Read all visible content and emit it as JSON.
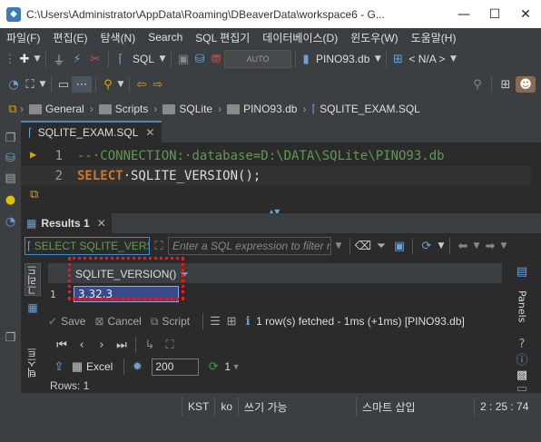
{
  "window": {
    "title": "C:\\Users\\Administrator\\AppData\\Roaming\\DBeaverData\\workspace6 - G...",
    "minimize": "—",
    "maximize": "☐",
    "close": "✕"
  },
  "menu": [
    "파일(F)",
    "편집(E)",
    "탐색(N)",
    "Search",
    "SQL 편집기",
    "데이터베이스(D)",
    "윈도우(W)",
    "도움말(H)"
  ],
  "toolbar1": {
    "sql_label": "SQL",
    "database": "PINO93.db",
    "schema": "< N/A >",
    "auto_label": "AUTO"
  },
  "breadcrumb": [
    "General",
    "Scripts",
    "SQLite",
    "PINO93.db",
    "SQLITE_EXAM.SQL"
  ],
  "editor": {
    "tab_label": "SQLITE_EXAM.SQL",
    "lines": [
      {
        "num": "1",
        "text": "--·CONNECTION:·database=D:\\DATA\\SQLite\\PINO93.db"
      },
      {
        "num": "2",
        "keyword": "SELECT",
        "rest": "·SQLITE_VERSION();"
      }
    ]
  },
  "results": {
    "tab_label": "Results 1",
    "query_text": "SELECT SQLITE_VERSION();",
    "filter_placeholder": "Enter a SQL expression to filter results (use Ctrl+Space)",
    "column_header": "SQLITE_VERSION()",
    "row_number": "1",
    "cell_value": "3.32.3",
    "side_tab_grid": "그리드",
    "side_tab_text": "텍스트",
    "save_label": "Save",
    "cancel_label": "Cancel",
    "script_label": "Script",
    "fetch_status": "1 row(s) fetched - 1ms (+1ms) [PINO93.db]",
    "excel_label": "Excel",
    "fetch_size": "200",
    "refresh_count": "1",
    "rows_label": "Rows: 1",
    "panels_label": "Panels"
  },
  "statusbar": {
    "timezone": "KST",
    "locale": "ko",
    "mode": "쓰기 가능",
    "insert_mode": "스마트 삽입",
    "position": "2 : 25 : 74"
  },
  "colors": {
    "accent": "#4a88c7",
    "comment": "#629755",
    "keyword": "#cc7832",
    "highlight_box": "#e02020"
  }
}
